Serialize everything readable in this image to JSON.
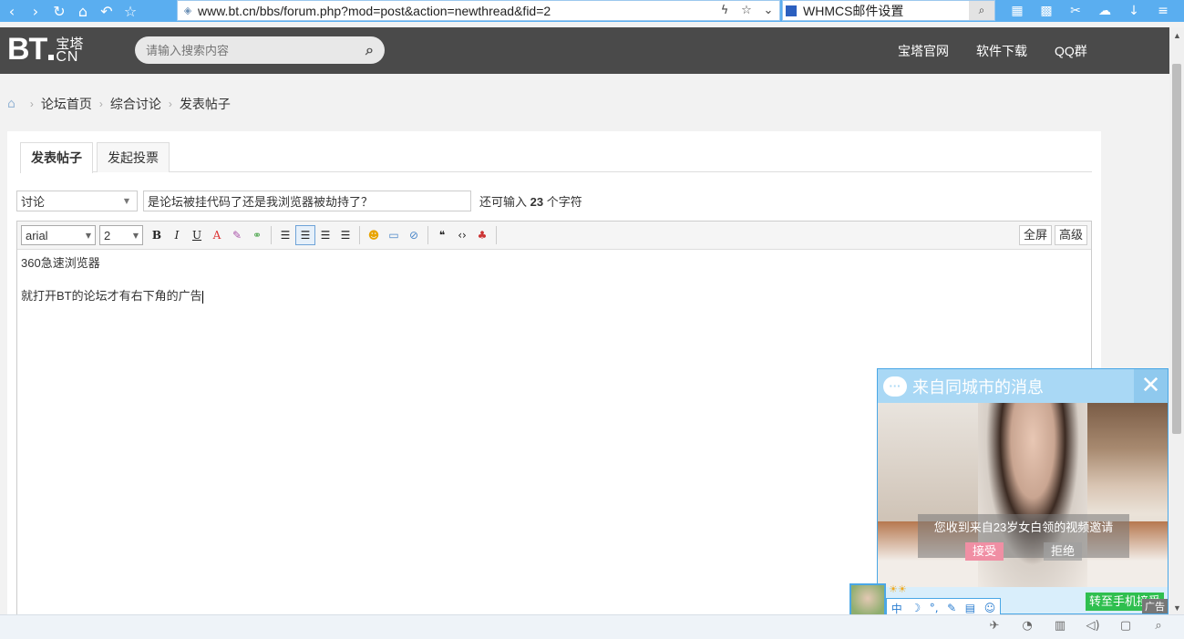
{
  "browser": {
    "url": "www.bt.cn/bbs/forum.php?mod=post&action=newthread&fid=2",
    "search_tab": "WHMCS邮件设置",
    "icons": [
      "back-icon",
      "forward-icon",
      "refresh-icon",
      "home-icon",
      "undo-icon",
      "star-icon"
    ]
  },
  "header": {
    "logo_main": "BT",
    "logo_cn": "宝塔",
    "logo_en": "CN",
    "search_placeholder": "请输入搜索内容",
    "nav": [
      "宝塔官网",
      "软件下载",
      "QQ群"
    ]
  },
  "breadcrumb": {
    "items": [
      "论坛首页",
      "综合讨论",
      "发表帖子"
    ]
  },
  "post": {
    "tabs": [
      "发表帖子",
      "发起投票"
    ],
    "category": "讨论",
    "title": "是论坛被挂代码了还是我浏览器被劫持了？",
    "char_prefix": "还可输入",
    "char_remaining": "23",
    "char_suffix": "个字符"
  },
  "editor": {
    "font": "arial",
    "size": "2",
    "fullscreen_label": "全屏",
    "advanced_label": "高级",
    "lines": [
      "360急速浏览器",
      "就打开BT的论坛才有右下角的广告"
    ]
  },
  "popup": {
    "title": "来自同城市的消息",
    "invite_text": "您收到来自23岁女白领的视频邀请",
    "accept_label": "接受",
    "reject_label": "拒绝",
    "mobile_label": "转至手机接受",
    "ad_label": "广告"
  },
  "qq": {
    "bar_items": [
      "中",
      "☽",
      "°,",
      "✎",
      "▤",
      "☺"
    ]
  },
  "colors": {
    "browser_bar": "#5aaef0",
    "site_header": "#4a4a4a",
    "popup_accent": "#4aa7e6",
    "accept_button": "#f08fa4",
    "mobile_button": "#2fbf4f"
  }
}
